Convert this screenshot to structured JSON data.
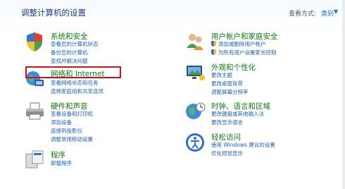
{
  "header": {
    "title": "调整计算机的设置",
    "view_by_label": "查看方式:",
    "view_by_value": "类别"
  },
  "left": [
    {
      "heading": "系统和安全",
      "icon": "shield-flag-icon",
      "links": [
        "查看您的计算机状态",
        "备份您的计算机",
        "查找并解决问题"
      ]
    },
    {
      "heading": "网络和 Internet",
      "icon": "network-globe-icon",
      "links": [
        "查看网络状态和任务",
        "选择家庭组和共享选项"
      ]
    },
    {
      "heading": "硬件和声音",
      "icon": "printer-icon",
      "links": [
        "查看设备和打印机",
        "添加设备",
        "连接到投影仪",
        "调整常用移动设置"
      ]
    },
    {
      "heading": "程序",
      "icon": "programs-icon",
      "links": [
        "卸载程序"
      ]
    }
  ],
  "right": [
    {
      "heading": "用户帐户和家庭安全",
      "icon": "users-icon",
      "links": [
        "添加或删除用户帐户",
        "为所有用户设置家长控制"
      ]
    },
    {
      "heading": "外观和个性化",
      "icon": "appearance-icon",
      "links": [
        "更改主题",
        "更改桌面背景",
        "调整屏幕分辨率"
      ]
    },
    {
      "heading": "时钟、语言和区域",
      "icon": "clock-globe-icon",
      "links": [
        "更改键盘或其他输入法",
        "更改显示语言"
      ]
    },
    {
      "heading": "轻松访问",
      "icon": "ease-of-access-icon",
      "links": [
        "使用 Windows 建议的设置",
        "优化视觉显示"
      ]
    }
  ],
  "colors": {
    "heading": "#107c10",
    "link": "#1d5fc4",
    "highlight": "#d0121b"
  }
}
